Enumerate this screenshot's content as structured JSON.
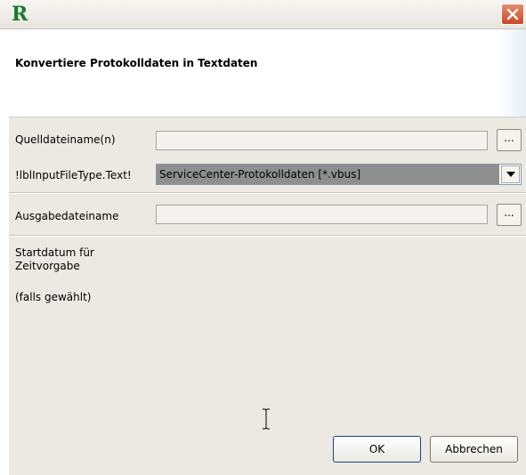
{
  "window": {
    "logo": "R",
    "close_icon": "close-icon"
  },
  "header": {
    "title": "Konvertiere Protokolldaten in Textdaten"
  },
  "form": {
    "source_label": "Quelldateiname(n)",
    "source_value": "",
    "source_browse": "...",
    "type_label": "!lblInputFileType.Text!",
    "type_value": "ServiceCenter-Protokolldaten [*.vbus]",
    "output_label": "Ausgabedateiname",
    "output_value": "",
    "output_browse": "...",
    "start_label_line1": "Startdatum für",
    "start_label_line2": "Zeitvorgabe",
    "start_note": "(falls gewählt)"
  },
  "buttons": {
    "ok": "OK",
    "cancel": "Abbrechen"
  },
  "colors": {
    "logo": "#1a7a2f",
    "close_button": "#d2603f",
    "dialog_bg": "#ebe9e2",
    "combo_selected_bg": "#8f8f8f"
  }
}
